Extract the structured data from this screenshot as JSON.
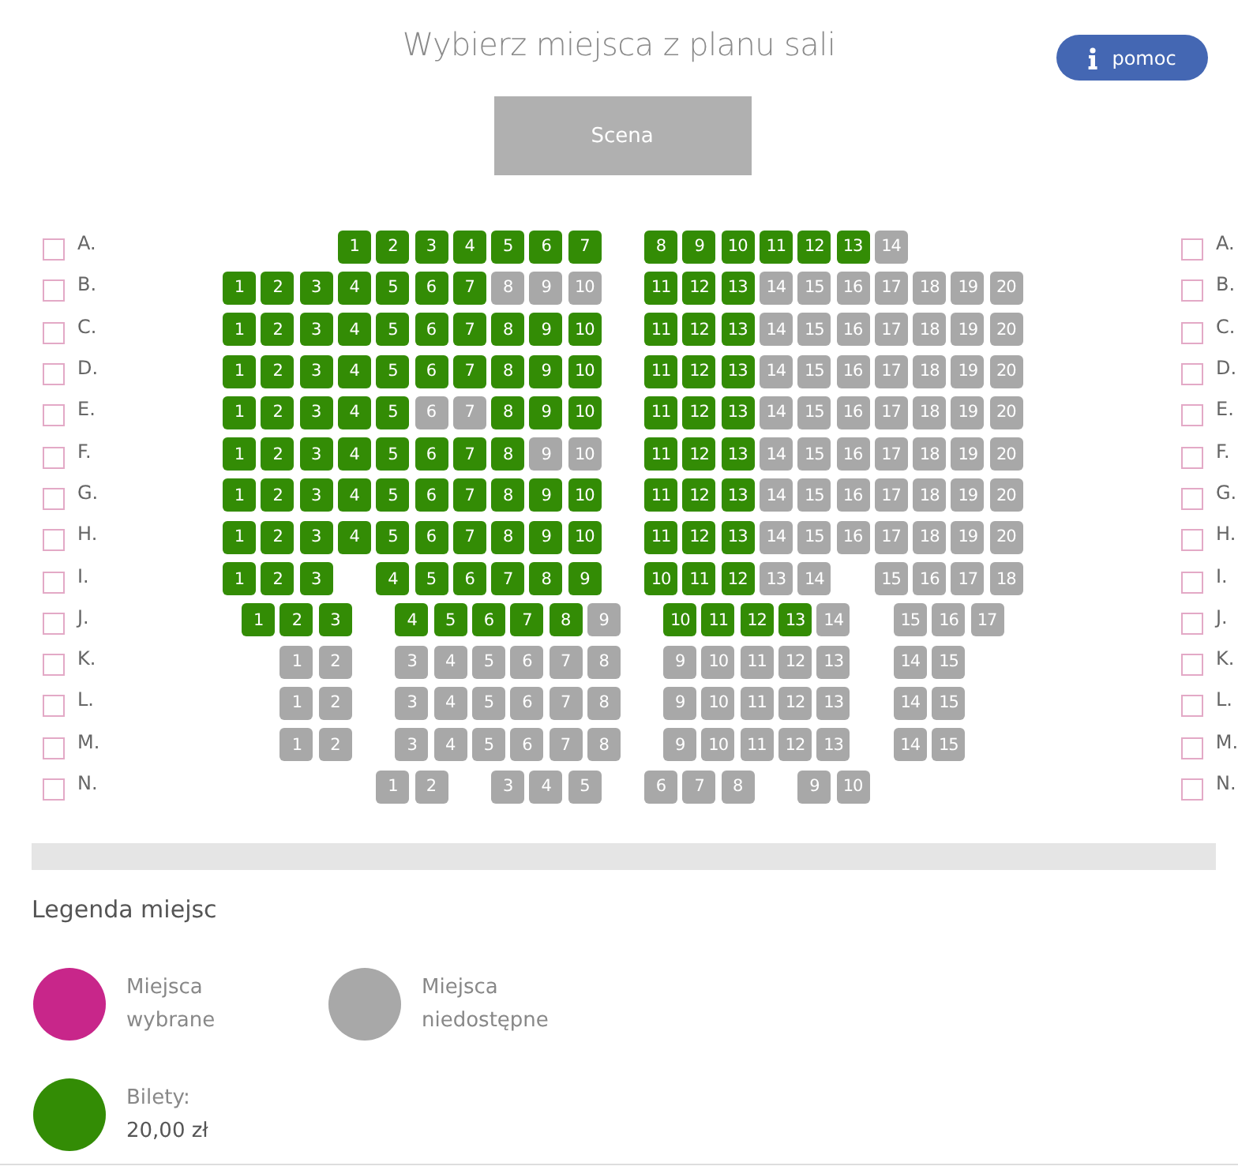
{
  "title": "Wybierz miejsca z planu sali",
  "help_button": {
    "label": "pomoc"
  },
  "stage": {
    "label": "Scena"
  },
  "rows": [
    {
      "left_label": "A.",
      "left_checked": false,
      "right_label": "A.",
      "right_checked": false,
      "left_seats": [
        {
          "number": "1",
          "available": true
        },
        {
          "number": "2",
          "available": true
        },
        {
          "number": "3",
          "available": true
        },
        {
          "number": "4",
          "available": true
        },
        {
          "number": "5",
          "available": true
        },
        {
          "number": "6",
          "available": true
        },
        {
          "number": "7",
          "available": true
        }
      ],
      "right_seats": [
        {
          "number": "8",
          "available": true
        },
        {
          "number": "9",
          "available": true
        },
        {
          "number": "10",
          "available": true
        },
        {
          "number": "11",
          "available": true
        },
        {
          "number": "12",
          "available": true
        },
        {
          "number": "13",
          "available": true
        },
        {
          "number": "14",
          "available": false
        }
      ]
    },
    {
      "left_label": "B.",
      "left_checked": false,
      "right_label": "B.",
      "right_checked": false,
      "left_seats": [
        {
          "number": "1",
          "available": true
        },
        {
          "number": "2",
          "available": true
        },
        {
          "number": "3",
          "available": true
        },
        {
          "number": "4",
          "available": true
        },
        {
          "number": "5",
          "available": true
        },
        {
          "number": "6",
          "available": true
        },
        {
          "number": "7",
          "available": true
        },
        {
          "number": "8",
          "available": false
        },
        {
          "number": "9",
          "available": false
        },
        {
          "number": "10",
          "available": false
        }
      ],
      "right_seats": [
        {
          "number": "11",
          "available": true
        },
        {
          "number": "12",
          "available": true
        },
        {
          "number": "13",
          "available": true
        },
        {
          "number": "14",
          "available": false
        },
        {
          "number": "15",
          "available": false
        },
        {
          "number": "16",
          "available": false
        },
        {
          "number": "17",
          "available": false
        },
        {
          "number": "18",
          "available": false
        },
        {
          "number": "19",
          "available": false
        },
        {
          "number": "20",
          "available": false
        }
      ]
    },
    {
      "left_label": "C.",
      "left_checked": false,
      "right_label": "C.",
      "right_checked": false,
      "left_seats": [
        {
          "number": "1",
          "available": true
        },
        {
          "number": "2",
          "available": true
        },
        {
          "number": "3",
          "available": true
        },
        {
          "number": "4",
          "available": true
        },
        {
          "number": "5",
          "available": true
        },
        {
          "number": "6",
          "available": true
        },
        {
          "number": "7",
          "available": true
        },
        {
          "number": "8",
          "available": true
        },
        {
          "number": "9",
          "available": true
        },
        {
          "number": "10",
          "available": true
        }
      ],
      "right_seats": [
        {
          "number": "11",
          "available": true
        },
        {
          "number": "12",
          "available": true
        },
        {
          "number": "13",
          "available": true
        },
        {
          "number": "14",
          "available": false
        },
        {
          "number": "15",
          "available": false
        },
        {
          "number": "16",
          "available": false
        },
        {
          "number": "17",
          "available": false
        },
        {
          "number": "18",
          "available": false
        },
        {
          "number": "19",
          "available": false
        },
        {
          "number": "20",
          "available": false
        }
      ]
    },
    {
      "left_label": "D.",
      "left_checked": false,
      "right_label": "D.",
      "right_checked": false,
      "left_seats": [
        {
          "number": "1",
          "available": true
        },
        {
          "number": "2",
          "available": true
        },
        {
          "number": "3",
          "available": true
        },
        {
          "number": "4",
          "available": true
        },
        {
          "number": "5",
          "available": true
        },
        {
          "number": "6",
          "available": true
        },
        {
          "number": "7",
          "available": true
        },
        {
          "number": "8",
          "available": true
        },
        {
          "number": "9",
          "available": true
        },
        {
          "number": "10",
          "available": true
        }
      ],
      "right_seats": [
        {
          "number": "11",
          "available": true
        },
        {
          "number": "12",
          "available": true
        },
        {
          "number": "13",
          "available": true
        },
        {
          "number": "14",
          "available": false
        },
        {
          "number": "15",
          "available": false
        },
        {
          "number": "16",
          "available": false
        },
        {
          "number": "17",
          "available": false
        },
        {
          "number": "18",
          "available": false
        },
        {
          "number": "19",
          "available": false
        },
        {
          "number": "20",
          "available": false
        }
      ]
    },
    {
      "left_label": "E.",
      "left_checked": false,
      "right_label": "E.",
      "right_checked": false,
      "left_seats": [
        {
          "number": "1",
          "available": true
        },
        {
          "number": "2",
          "available": true
        },
        {
          "number": "3",
          "available": true
        },
        {
          "number": "4",
          "available": true
        },
        {
          "number": "5",
          "available": true
        },
        {
          "number": "6",
          "available": false
        },
        {
          "number": "7",
          "available": false
        },
        {
          "number": "8",
          "available": true
        },
        {
          "number": "9",
          "available": true
        },
        {
          "number": "10",
          "available": true
        }
      ],
      "right_seats": [
        {
          "number": "11",
          "available": true
        },
        {
          "number": "12",
          "available": true
        },
        {
          "number": "13",
          "available": true
        },
        {
          "number": "14",
          "available": false
        },
        {
          "number": "15",
          "available": false
        },
        {
          "number": "16",
          "available": false
        },
        {
          "number": "17",
          "available": false
        },
        {
          "number": "18",
          "available": false
        },
        {
          "number": "19",
          "available": false
        },
        {
          "number": "20",
          "available": false
        }
      ]
    },
    {
      "left_label": "F.",
      "left_checked": false,
      "right_label": "F.",
      "right_checked": false,
      "left_seats": [
        {
          "number": "1",
          "available": true
        },
        {
          "number": "2",
          "available": true
        },
        {
          "number": "3",
          "available": true
        },
        {
          "number": "4",
          "available": true
        },
        {
          "number": "5",
          "available": true
        },
        {
          "number": "6",
          "available": true
        },
        {
          "number": "7",
          "available": true
        },
        {
          "number": "8",
          "available": true
        },
        {
          "number": "9",
          "available": false
        },
        {
          "number": "10",
          "available": false
        }
      ],
      "right_seats": [
        {
          "number": "11",
          "available": true
        },
        {
          "number": "12",
          "available": true
        },
        {
          "number": "13",
          "available": true
        },
        {
          "number": "14",
          "available": false
        },
        {
          "number": "15",
          "available": false
        },
        {
          "number": "16",
          "available": false
        },
        {
          "number": "17",
          "available": false
        },
        {
          "number": "18",
          "available": false
        },
        {
          "number": "19",
          "available": false
        },
        {
          "number": "20",
          "available": false
        }
      ]
    },
    {
      "left_label": "G.",
      "left_checked": false,
      "right_label": "G.",
      "right_checked": false,
      "left_seats": [
        {
          "number": "1",
          "available": true
        },
        {
          "number": "2",
          "available": true
        },
        {
          "number": "3",
          "available": true
        },
        {
          "number": "4",
          "available": true
        },
        {
          "number": "5",
          "available": true
        },
        {
          "number": "6",
          "available": true
        },
        {
          "number": "7",
          "available": true
        },
        {
          "number": "8",
          "available": true
        },
        {
          "number": "9",
          "available": true
        },
        {
          "number": "10",
          "available": true
        }
      ],
      "right_seats": [
        {
          "number": "11",
          "available": true
        },
        {
          "number": "12",
          "available": true
        },
        {
          "number": "13",
          "available": true
        },
        {
          "number": "14",
          "available": false
        },
        {
          "number": "15",
          "available": false
        },
        {
          "number": "16",
          "available": false
        },
        {
          "number": "17",
          "available": false
        },
        {
          "number": "18",
          "available": false
        },
        {
          "number": "19",
          "available": false
        },
        {
          "number": "20",
          "available": false
        }
      ]
    },
    {
      "left_label": "H.",
      "left_checked": false,
      "right_label": "H.",
      "right_checked": false,
      "left_seats": [
        {
          "number": "1",
          "available": true
        },
        {
          "number": "2",
          "available": true
        },
        {
          "number": "3",
          "available": true
        },
        {
          "number": "4",
          "available": true
        },
        {
          "number": "5",
          "available": true
        },
        {
          "number": "6",
          "available": true
        },
        {
          "number": "7",
          "available": true
        },
        {
          "number": "8",
          "available": true
        },
        {
          "number": "9",
          "available": true
        },
        {
          "number": "10",
          "available": true
        }
      ],
      "right_seats": [
        {
          "number": "11",
          "available": true
        },
        {
          "number": "12",
          "available": true
        },
        {
          "number": "13",
          "available": true
        },
        {
          "number": "14",
          "available": false
        },
        {
          "number": "15",
          "available": false
        },
        {
          "number": "16",
          "available": false
        },
        {
          "number": "17",
          "available": false
        },
        {
          "number": "18",
          "available": false
        },
        {
          "number": "19",
          "available": false
        },
        {
          "number": "20",
          "available": false
        }
      ]
    },
    {
      "left_label": "I.",
      "left_checked": false,
      "right_label": "I.",
      "right_checked": false,
      "left_seats": [
        {
          "number": "1",
          "available": true
        },
        {
          "number": "2",
          "available": true
        },
        {
          "number": "3",
          "available": true
        },
        {
          "number": "4",
          "available": true
        },
        {
          "number": "5",
          "available": true
        },
        {
          "number": "6",
          "available": true
        },
        {
          "number": "7",
          "available": true
        },
        {
          "number": "8",
          "available": true
        },
        {
          "number": "9",
          "available": true
        }
      ],
      "right_seats": [
        {
          "number": "10",
          "available": true
        },
        {
          "number": "11",
          "available": true
        },
        {
          "number": "12",
          "available": true
        },
        {
          "number": "13",
          "available": false
        },
        {
          "number": "14",
          "available": false
        },
        {
          "number": "15",
          "available": false
        },
        {
          "number": "16",
          "available": false
        },
        {
          "number": "17",
          "available": false
        },
        {
          "number": "18",
          "available": false
        }
      ]
    },
    {
      "left_label": "J.",
      "left_checked": false,
      "right_label": "J.",
      "right_checked": false,
      "left_seats": [
        {
          "number": "1",
          "available": true
        },
        {
          "number": "2",
          "available": true
        },
        {
          "number": "3",
          "available": true
        },
        {
          "number": "4",
          "available": true
        },
        {
          "number": "5",
          "available": true
        },
        {
          "number": "6",
          "available": true
        },
        {
          "number": "7",
          "available": true
        },
        {
          "number": "8",
          "available": true
        },
        {
          "number": "9",
          "available": false
        }
      ],
      "right_seats": [
        {
          "number": "10",
          "available": true
        },
        {
          "number": "11",
          "available": true
        },
        {
          "number": "12",
          "available": true
        },
        {
          "number": "13",
          "available": true
        },
        {
          "number": "14",
          "available": false
        },
        {
          "number": "15",
          "available": false
        },
        {
          "number": "16",
          "available": false
        },
        {
          "number": "17",
          "available": false
        }
      ]
    },
    {
      "left_label": "K.",
      "left_checked": false,
      "right_label": "K.",
      "right_checked": false,
      "left_seats": [
        {
          "number": "1",
          "available": false
        },
        {
          "number": "2",
          "available": false
        },
        {
          "number": "3",
          "available": false
        },
        {
          "number": "4",
          "available": false
        },
        {
          "number": "5",
          "available": false
        },
        {
          "number": "6",
          "available": false
        },
        {
          "number": "7",
          "available": false
        },
        {
          "number": "8",
          "available": false
        }
      ],
      "right_seats": [
        {
          "number": "9",
          "available": false
        },
        {
          "number": "10",
          "available": false
        },
        {
          "number": "11",
          "available": false
        },
        {
          "number": "12",
          "available": false
        },
        {
          "number": "13",
          "available": false
        },
        {
          "number": "14",
          "available": false
        },
        {
          "number": "15",
          "available": false
        }
      ]
    },
    {
      "left_label": "L.",
      "left_checked": false,
      "right_label": "L.",
      "right_checked": false,
      "left_seats": [
        {
          "number": "1",
          "available": false
        },
        {
          "number": "2",
          "available": false
        },
        {
          "number": "3",
          "available": false
        },
        {
          "number": "4",
          "available": false
        },
        {
          "number": "5",
          "available": false
        },
        {
          "number": "6",
          "available": false
        },
        {
          "number": "7",
          "available": false
        },
        {
          "number": "8",
          "available": false
        }
      ],
      "right_seats": [
        {
          "number": "9",
          "available": false
        },
        {
          "number": "10",
          "available": false
        },
        {
          "number": "11",
          "available": false
        },
        {
          "number": "12",
          "available": false
        },
        {
          "number": "13",
          "available": false
        },
        {
          "number": "14",
          "available": false
        },
        {
          "number": "15",
          "available": false
        }
      ]
    },
    {
      "left_label": "M.",
      "left_checked": false,
      "right_label": "M.",
      "right_checked": false,
      "left_seats": [
        {
          "number": "1",
          "available": false
        },
        {
          "number": "2",
          "available": false
        },
        {
          "number": "3",
          "available": false
        },
        {
          "number": "4",
          "available": false
        },
        {
          "number": "5",
          "available": false
        },
        {
          "number": "6",
          "available": false
        },
        {
          "number": "7",
          "available": false
        },
        {
          "number": "8",
          "available": false
        }
      ],
      "right_seats": [
        {
          "number": "9",
          "available": false
        },
        {
          "number": "10",
          "available": false
        },
        {
          "number": "11",
          "available": false
        },
        {
          "number": "12",
          "available": false
        },
        {
          "number": "13",
          "available": false
        },
        {
          "number": "14",
          "available": false
        },
        {
          "number": "15",
          "available": false
        }
      ]
    },
    {
      "left_label": "N.",
      "left_checked": false,
      "right_label": "N.",
      "right_checked": false,
      "left_seats": [
        {
          "number": "1",
          "available": false
        },
        {
          "number": "2",
          "available": false
        },
        {
          "number": "3",
          "available": false
        },
        {
          "number": "4",
          "available": false
        },
        {
          "number": "5",
          "available": false
        }
      ],
      "right_seats": [
        {
          "number": "6",
          "available": false
        },
        {
          "number": "7",
          "available": false
        },
        {
          "number": "8",
          "available": false
        },
        {
          "number": "9",
          "available": false
        },
        {
          "number": "10",
          "available": false
        }
      ]
    }
  ],
  "legend": {
    "title": "Legenda miejsc",
    "items": [
      {
        "text": "Miejsca wybrane",
        "color": "#c8268a"
      },
      {
        "text": "Miejsca niedostępne",
        "color": "#a8a8a8"
      },
      {
        "text": "Bilety:",
        "price": "20,00 zł",
        "color": "#338c05"
      }
    ]
  }
}
